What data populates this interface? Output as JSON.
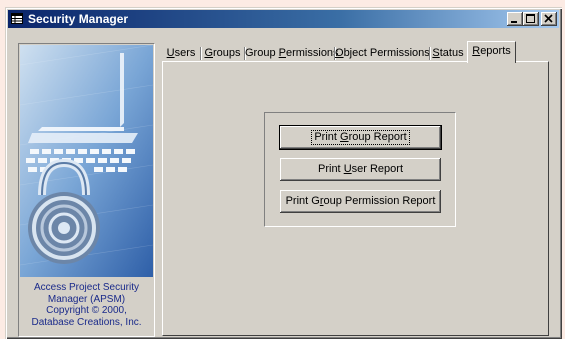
{
  "window": {
    "title": "Security Manager",
    "icons": {
      "app": "table-icon",
      "minimize": "minimize-icon",
      "maximize": "maximize-icon",
      "close": "close-icon"
    }
  },
  "sidebar": {
    "logo": "laptop-padlock-logo",
    "credit_lines": [
      "Access Project Security",
      "Manager (APSM)",
      "Copyright © 2000,",
      "Database Creations, Inc."
    ]
  },
  "tabs": [
    {
      "pre": "",
      "key": "U",
      "post": "sers"
    },
    {
      "pre": "",
      "key": "G",
      "post": "roups"
    },
    {
      "pre": "Group ",
      "key": "P",
      "post": "ermissions"
    },
    {
      "pre": "",
      "key": "O",
      "post": "bject Permissions"
    },
    {
      "pre": "",
      "key": "S",
      "post": "tatus"
    },
    {
      "pre": "",
      "key": "R",
      "post": "eports"
    }
  ],
  "active_tab": "Reports",
  "reports": {
    "buttons": [
      {
        "pre": "Print ",
        "key": "G",
        "post": "roup Report"
      },
      {
        "pre": "Print ",
        "key": "U",
        "post": "ser Report"
      },
      {
        "pre": "Print G",
        "key": "r",
        "post": "oup Permission Report"
      }
    ]
  },
  "colors": {
    "face": "#d4d0c8",
    "title_start": "#0a246a",
    "title_end": "#a6caf0",
    "credit_text": "#1a2a8a",
    "desktop": "#fcebe4"
  }
}
